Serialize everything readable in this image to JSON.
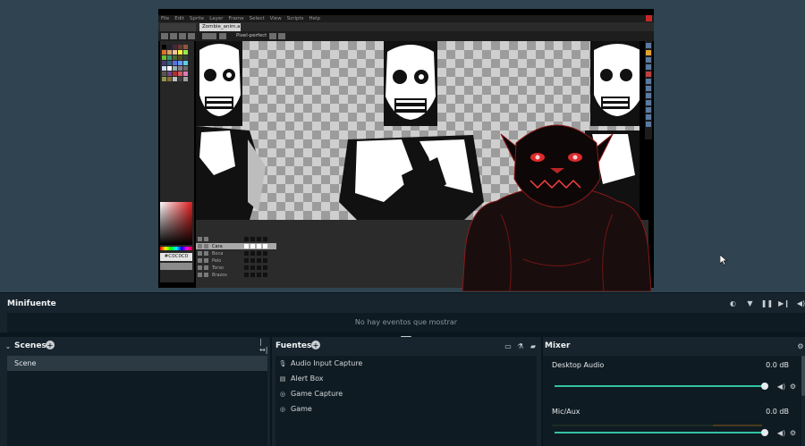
{
  "editor": {
    "menu": [
      "File",
      "Edit",
      "Sprite",
      "Layer",
      "Frame",
      "Select",
      "View",
      "Scripts",
      "Help"
    ],
    "tab_title": "Zombie_anim.a",
    "pixel_perfect_label": "Pixel-perfect",
    "hex_color": "#C0C0C0",
    "layers": [
      "Cara",
      "Boca",
      "Pelo",
      "Torso",
      "Brazos"
    ],
    "selected_layer": "Cara"
  },
  "activity_feed": {
    "title": "Minifuente",
    "empty_text": "No hay eventos que mostrar"
  },
  "scenes": {
    "title": "Scenes",
    "items": [
      {
        "label": "Scene"
      }
    ]
  },
  "sources": {
    "title": "Fuentes",
    "items": [
      {
        "label": "Audio Input Capture",
        "icon": "microphone-icon"
      },
      {
        "label": "Alert Box",
        "icon": "widget-icon"
      },
      {
        "label": "Game Capture",
        "icon": "gamepad-icon"
      },
      {
        "label": "Game",
        "icon": "gamepad-icon"
      }
    ]
  },
  "mixer": {
    "title": "Mixer",
    "channels": [
      {
        "name": "Desktop Audio",
        "level": "0.0 dB",
        "volume_fraction": 1.0
      },
      {
        "name": "Mic/Aux",
        "level": "0.0 dB",
        "volume_fraction": 1.0
      }
    ]
  },
  "colors": {
    "accent": "#31c3a2",
    "panel": "#17242d",
    "panel_body": "#0f1b22",
    "preview_bg": "#2f4450",
    "selected_item": "#2c3a44"
  }
}
